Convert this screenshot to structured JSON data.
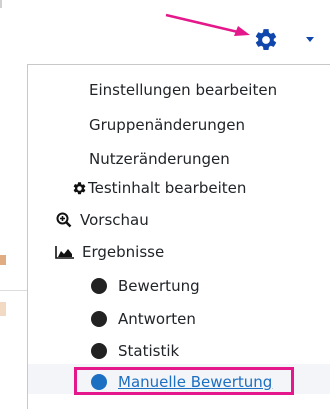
{
  "header": {
    "gear_icon": "gear-icon",
    "caret_icon": "chevron-down-icon",
    "annotation_arrow_color": "#e4178b"
  },
  "menu": {
    "items": [
      {
        "label": "Einstellungen bearbeiten"
      },
      {
        "label": "Gruppenänderungen"
      },
      {
        "label": "Nutzeränderungen"
      },
      {
        "label": "Testinhalt bearbeiten",
        "icon": "gear-icon"
      },
      {
        "label": "Vorschau",
        "icon": "zoom-in-icon"
      },
      {
        "label": "Ergebnisse",
        "icon": "area-chart-icon"
      },
      {
        "label": "Bewertung",
        "icon": "bullet-icon"
      },
      {
        "label": "Antworten",
        "icon": "bullet-icon"
      },
      {
        "label": "Statistik",
        "icon": "bullet-icon"
      },
      {
        "label": "Manuelle Bewertung",
        "icon": "bullet-icon",
        "highlighted": true
      }
    ]
  },
  "colors": {
    "link": "#1d6fc2",
    "highlight_border": "#e4178b"
  }
}
